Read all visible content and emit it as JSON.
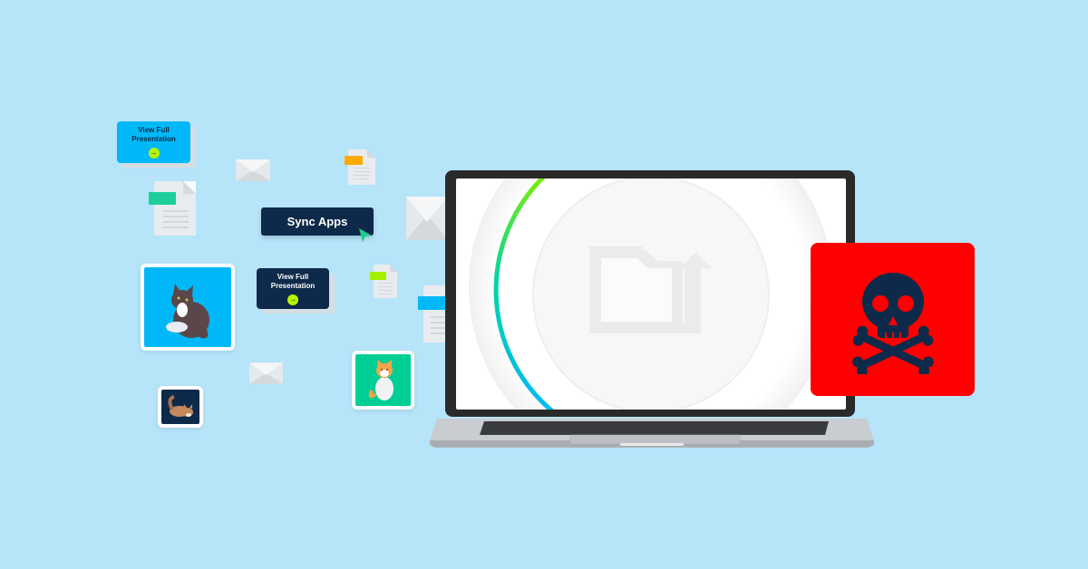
{
  "scene": {
    "background_color": "#b6e4f9",
    "description": "Laptop with sync/upload screen surrounded by floating apps, documents, emails and cat images; a red danger card with a skull and crossbones"
  },
  "presentation_cards": [
    {
      "line1": "View Full",
      "line2": "Presentation",
      "action_icon": "arrow-right-icon",
      "bg_color": "#00b8f8"
    },
    {
      "line1": "View Full",
      "line2": "Presentation",
      "action_icon": "arrow-right-icon",
      "bg_color": "#0e2a4a"
    }
  ],
  "sync_button": {
    "label": "Sync Apps",
    "bg_color": "#0e2a4a",
    "cursor_color": "#1fce8e"
  },
  "documents": [
    {
      "tab_color": "#1fce9a"
    },
    {
      "tab_color": "#ffaa00"
    },
    {
      "tab_color": "#a4f000"
    },
    {
      "tab_color": "#00b8f8"
    }
  ],
  "cat_tiles": [
    {
      "subject": "dark brown long-haired cat",
      "bg_color": "#00b8f8"
    },
    {
      "subject": "orange and white cat",
      "bg_color": "#00cf95"
    },
    {
      "subject": "stretching tabby cat",
      "bg_color": "#0e2a4a"
    }
  ],
  "laptop": {
    "screen_icon": "folder-upload-icon",
    "progress_ring_colors": [
      "#7cf000",
      "#00b8f8"
    ]
  },
  "danger_card": {
    "icon": "skull-crossbones-icon",
    "bg_color": "#ff0000",
    "icon_color": "#0e2a4a"
  }
}
